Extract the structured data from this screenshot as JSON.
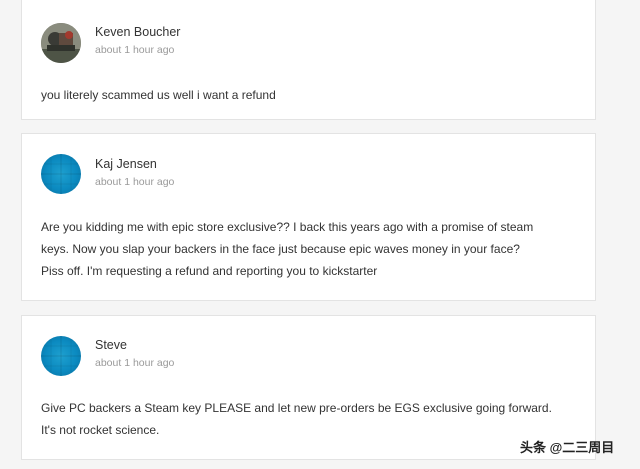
{
  "comments": [
    {
      "author": "Keven Boucher",
      "time": "about 1 hour ago",
      "lines": [
        "you literely scammed us well i want a refund"
      ]
    },
    {
      "author": "Kaj Jensen",
      "time": "about 1 hour ago",
      "lines": [
        "Are you kidding me with epic store exclusive?? I back this years ago with a promise of steam",
        "keys. Now you slap your backers in the face just because epic waves money in your face?",
        "Piss off. I'm requesting a refund and reporting you to kickstarter"
      ]
    },
    {
      "author": "Steve",
      "time": "about 1 hour ago",
      "lines": [
        "Give PC backers a Steam key PLEASE and let new pre-orders be EGS exclusive going forward.",
        "It's not rocket science."
      ]
    }
  ],
  "watermark": "头条 @二三周目",
  "colors": {
    "avatar_blue": "#0b8ac0"
  }
}
